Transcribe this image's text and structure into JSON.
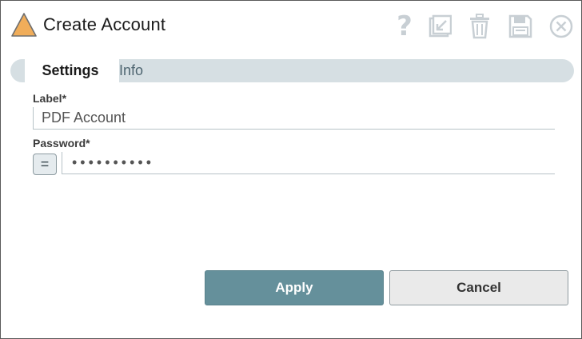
{
  "dialog": {
    "title": "Create Account",
    "icons": {
      "logo": "triangle-logo-icon",
      "help": "help-icon",
      "export": "export-icon",
      "delete": "trash-icon",
      "save": "save-icon",
      "close": "close-icon"
    },
    "help_glyph": "?"
  },
  "tabs": [
    {
      "label": "Settings",
      "active": true
    },
    {
      "label": "Info",
      "active": false
    }
  ],
  "form": {
    "label_field": {
      "label": "Label*",
      "value": "PDF Account"
    },
    "password_field": {
      "label": "Password*",
      "value": "••••••••••",
      "expression_toggle": "="
    }
  },
  "buttons": {
    "apply": "Apply",
    "cancel": "Cancel"
  },
  "colors": {
    "accent": "#65909b",
    "logo": "#f0ad5a",
    "tabbar": "#d6dfe3",
    "icon_gray": "#c8cfd4"
  }
}
